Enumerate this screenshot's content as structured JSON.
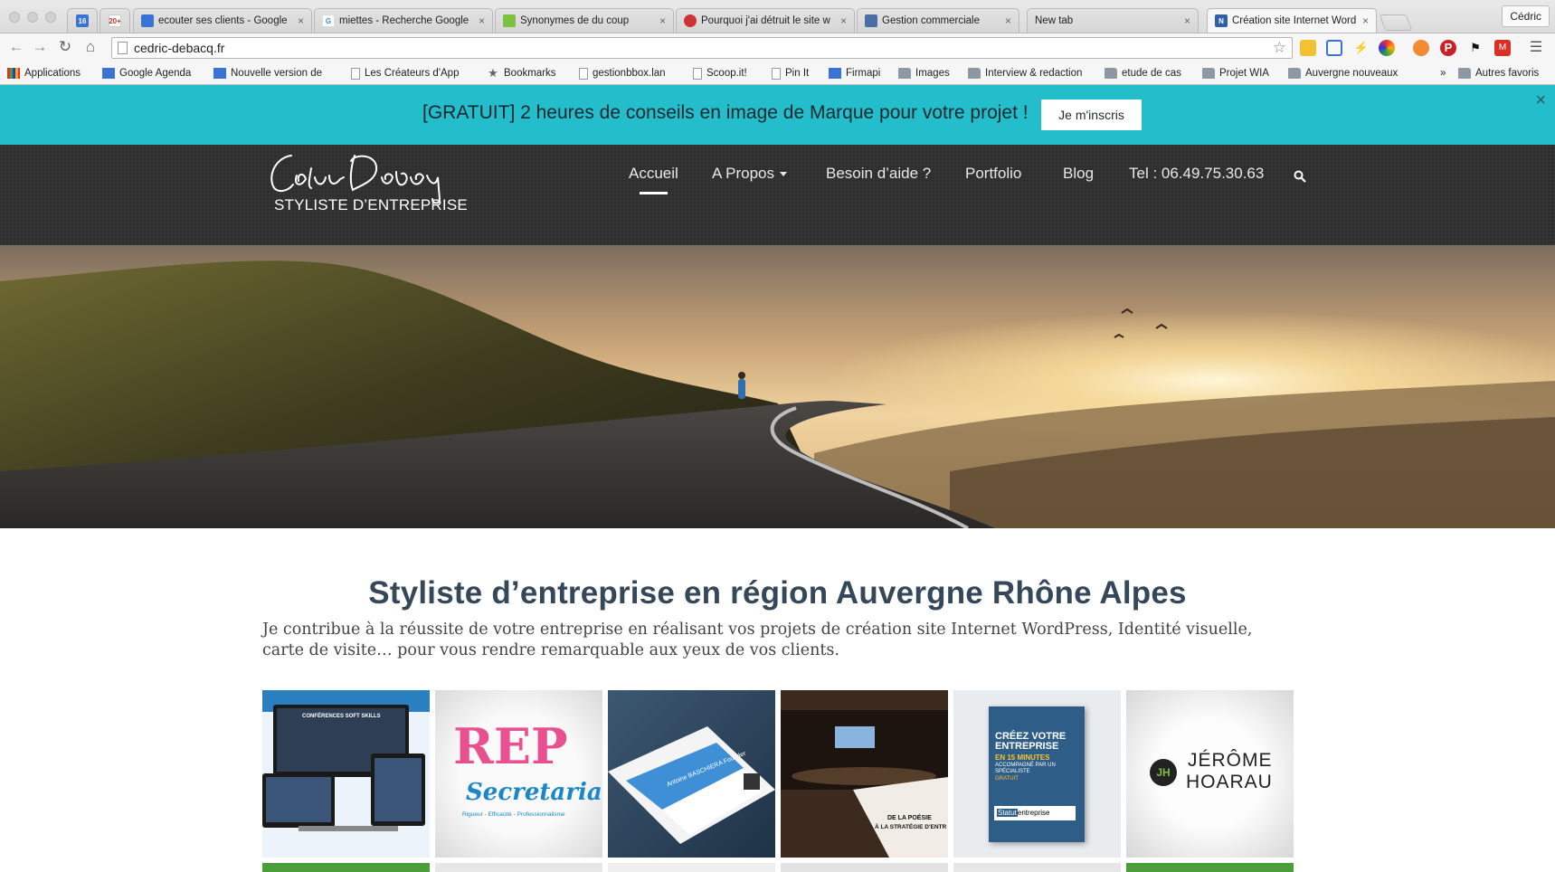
{
  "browser": {
    "pinned_tabs": [
      {
        "name": "calendar-pinned-tab",
        "badge": "16"
      },
      {
        "name": "gmail-pinned-tab",
        "badge": "20+"
      }
    ],
    "tabs": [
      {
        "title": "ecouter ses clients - Google",
        "icon_color": "#3b73d4"
      },
      {
        "title": "miettes - Recherche Google",
        "icon_color": "#ffffff"
      },
      {
        "title": "Synonymes de du coup",
        "icon_color": "#7cc142"
      },
      {
        "title": "Pourquoi j'ai détruit le site w",
        "icon_color": "#cc3333"
      },
      {
        "title": "Gestion commerciale",
        "icon_color": "#4a6fa5"
      },
      {
        "title": "New tab",
        "icon_color": ""
      },
      {
        "title": "Création site Internet Wordp",
        "icon_color": "#2f5fa8"
      }
    ],
    "tab_close": "×",
    "profile_name": "Cédric",
    "url": "cedric-debacq.fr",
    "bookmarks": [
      {
        "label": "Applications",
        "icon": "grid"
      },
      {
        "label": "Google Agenda",
        "icon": "blue"
      },
      {
        "label": "Nouvelle version de",
        "icon": "blue"
      },
      {
        "label": "Les Créateurs d'App",
        "icon": "doc"
      },
      {
        "label": "Bookmarks",
        "icon": "star"
      },
      {
        "label": "gestionbbox.lan",
        "icon": "doc"
      },
      {
        "label": "Scoop.it!",
        "icon": "doc"
      },
      {
        "label": "Pin It",
        "icon": "doc"
      },
      {
        "label": "Firmapi",
        "icon": "blue"
      },
      {
        "label": "Images",
        "icon": "folder"
      },
      {
        "label": "Interview & redaction",
        "icon": "folder"
      },
      {
        "label": "etude de cas",
        "icon": "folder"
      },
      {
        "label": "Projet WIA",
        "icon": "folder"
      },
      {
        "label": "Auvergne nouveaux",
        "icon": "folder"
      },
      {
        "label": "»",
        "icon": ""
      },
      {
        "label": "Autres favoris",
        "icon": "folder"
      }
    ]
  },
  "promo": {
    "text": "[GRATUIT] 2 heures de conseils en image de Marque pour votre projet !",
    "button": "Je m'inscris",
    "close": "×",
    "bg_color": "#24bdcb"
  },
  "site": {
    "logo_tagline": "STYLISTE D’ENTREPRISE",
    "menu": [
      {
        "label": "Accueil",
        "active": true
      },
      {
        "label": "A Propos",
        "dropdown": true
      },
      {
        "label": "Besoin d’aide ?"
      },
      {
        "label": "Portfolio"
      },
      {
        "label": "Blog"
      },
      {
        "label": "Tel : 06.49.75.30.63"
      }
    ],
    "heading": "Styliste d’entreprise en région Auvergne Rhône Alpes",
    "intro": "Je contribue à la réussite de votre entreprise en réalisant vos projets de création site Internet WordPress, Identité visuelle, carte de visite… pour vous rendre remarquable aux yeux de vos clients.",
    "portfolio": [
      {
        "name": "conferences-soft-skills",
        "label": "CONFÉRENCES SOFT SKILLS"
      },
      {
        "name": "rep-secretariat",
        "label_top": "REP",
        "label_mid": "Secretariat",
        "label_bottom": "Rigueur - Efficacité - Professionnalisme"
      },
      {
        "name": "business-card",
        "label": "Antoine BASCHIERA",
        "sub": "Founder"
      },
      {
        "name": "la-poesie",
        "label_top": "DE LA POÉSIE",
        "label_bottom": "À LA STRATÉGIE D'ENTR"
      },
      {
        "name": "statut-entreprise",
        "label_top": "CRÉEZ VOTRE ENTREPRISE",
        "label_mid": "EN 15 MINUTES",
        "label_sub": "ACCOMPAGNÉ PAR UN SPÉCIALISTE",
        "label_free": "GRATUIT",
        "label_logo_a": "Statut",
        "label_logo_b": "entreprise"
      },
      {
        "name": "jerome-hoarau",
        "label_a": "JÉRÔME",
        "label_b": "HOARAU",
        "initials": "JH"
      }
    ]
  }
}
